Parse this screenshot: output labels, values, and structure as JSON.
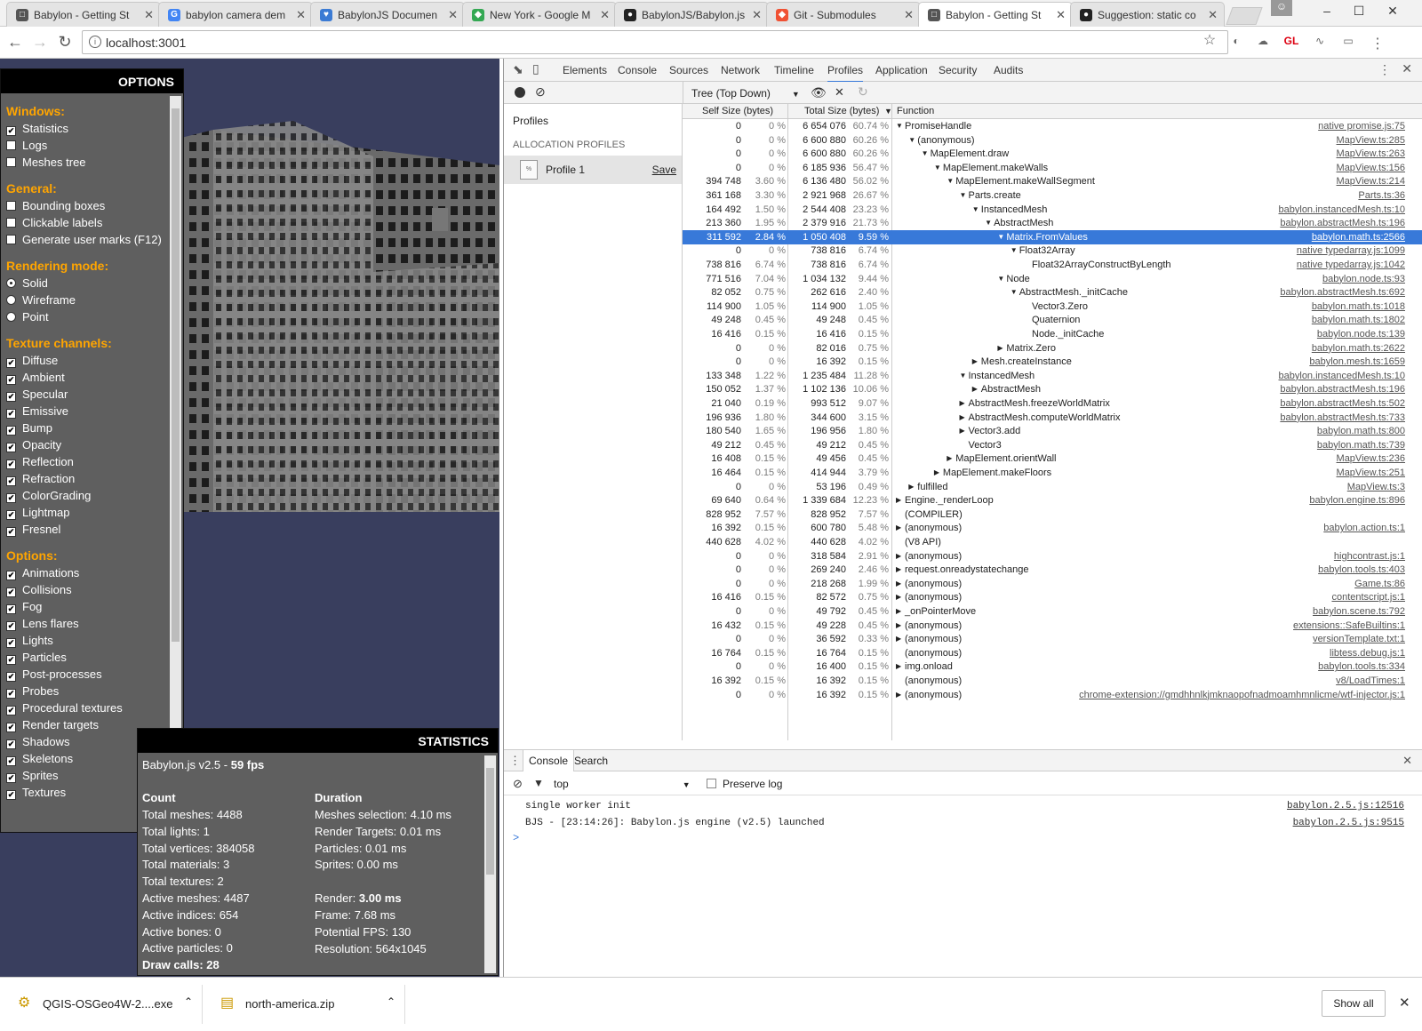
{
  "browser": {
    "tabs": [
      "Babylon - Getting St",
      "babylon camera dem",
      "BabylonJS Documen",
      "New York - Google M",
      "BabylonJS/Babylon.js",
      "Git - Submodules",
      "Babylon - Getting St",
      "Suggestion: static co"
    ],
    "url": "localhost:3001",
    "ext_gl": "GL"
  },
  "options": {
    "title": "OPTIONS",
    "windows_title": "Windows:",
    "windows": [
      "Statistics",
      "Logs",
      "Meshes tree"
    ],
    "general_title": "General:",
    "general": [
      "Bounding boxes",
      "Clickable labels",
      "Generate user marks (F12)"
    ],
    "render_title": "Rendering mode:",
    "render": [
      "Solid",
      "Wireframe",
      "Point"
    ],
    "texture_title": "Texture channels:",
    "textures": [
      "Diffuse",
      "Ambient",
      "Specular",
      "Emissive",
      "Bump",
      "Opacity",
      "Reflection",
      "Refraction",
      "ColorGrading",
      "Lightmap",
      "Fresnel"
    ],
    "opt_title": "Options:",
    "opts": [
      "Animations",
      "Collisions",
      "Fog",
      "Lens flares",
      "Lights",
      "Particles",
      "Post-processes",
      "Probes",
      "Procedural textures",
      "Render targets",
      "Shadows",
      "Skeletons",
      "Sprites",
      "Textures"
    ]
  },
  "stats": {
    "title": "STATISTICS",
    "version": "Babylon.js v2.5 - ",
    "fps": "59 fps",
    "count_title": "Count",
    "duration_title": "Duration",
    "left": [
      "Total meshes: 4488",
      "Total lights: 1",
      "Total vertices: 384058",
      "Total materials: 3",
      "Total textures: 2",
      "Active meshes: 4487",
      "Active indices: 654",
      "Active bones: 0",
      "Active particles: 0"
    ],
    "draw": "Draw calls: 28",
    "right": [
      "Meshes selection: 4.10 ms",
      "Render Targets: 0.01 ms",
      "Particles: 0.01 ms",
      "Sprites: 0.00 ms"
    ],
    "render_label": "Render: ",
    "render_val": "3.00 ms",
    "right2": [
      "Frame: 7.68 ms",
      "Potential FPS: 130",
      "Resolution: 564x1045"
    ]
  },
  "devtools": {
    "tabs": [
      "Elements",
      "Console",
      "Sources",
      "Network",
      "Timeline",
      "Profiles",
      "Application",
      "Security",
      "Audits"
    ],
    "view_select": "Tree (Top Down)",
    "profiles_label": "Profiles",
    "alloc_label": "ALLOCATION PROFILES",
    "profile_name": "Profile 1",
    "save": "Save",
    "columns": [
      "Self Size (bytes)",
      "Total Size (bytes)",
      "Function"
    ],
    "rows": [
      [
        "0",
        "0 %",
        "6 654 076",
        "60.74 %",
        0,
        "PromiseHandle",
        "native promise.js:75",
        1
      ],
      [
        "0",
        "0 %",
        "6 600 880",
        "60.26 %",
        1,
        "(anonymous)",
        "MapView.ts:285",
        1
      ],
      [
        "0",
        "0 %",
        "6 600 880",
        "60.26 %",
        2,
        "MapElement.draw",
        "MapView.ts:263",
        1
      ],
      [
        "0",
        "0 %",
        "6 185 936",
        "56.47 %",
        3,
        "MapElement.makeWalls",
        "MapView.ts:156",
        1
      ],
      [
        "394 748",
        "3.60 %",
        "6 136 480",
        "56.02 %",
        4,
        "MapElement.makeWallSegment",
        "MapView.ts:214",
        1
      ],
      [
        "361 168",
        "3.30 %",
        "2 921 968",
        "26.67 %",
        5,
        "Parts.create",
        "Parts.ts:36",
        1
      ],
      [
        "164 492",
        "1.50 %",
        "2 544 408",
        "23.23 %",
        6,
        "InstancedMesh",
        "babylon.instancedMesh.ts:10",
        1
      ],
      [
        "213 360",
        "1.95 %",
        "2 379 916",
        "21.73 %",
        7,
        "AbstractMesh",
        "babylon.abstractMesh.ts:196",
        1
      ],
      [
        "311 592",
        "2.84 %",
        "1 050 408",
        "9.59 %",
        8,
        "Matrix.FromValues",
        "babylon.math.ts:2566",
        1
      ],
      [
        "0",
        "0 %",
        "738 816",
        "6.74 %",
        9,
        "Float32Array",
        "native typedarray.js:1099",
        1
      ],
      [
        "738 816",
        "6.74 %",
        "738 816",
        "6.74 %",
        10,
        "Float32ArrayConstructByLength",
        "native typedarray.js:1042",
        0
      ],
      [
        "771 516",
        "7.04 %",
        "1 034 132",
        "9.44 %",
        8,
        "Node",
        "babylon.node.ts:93",
        1
      ],
      [
        "82 052",
        "0.75 %",
        "262 616",
        "2.40 %",
        9,
        "AbstractMesh._initCache",
        "babylon.abstractMesh.ts:692",
        1
      ],
      [
        "114 900",
        "1.05 %",
        "114 900",
        "1.05 %",
        10,
        "Vector3.Zero",
        "babylon.math.ts:1018",
        0
      ],
      [
        "49 248",
        "0.45 %",
        "49 248",
        "0.45 %",
        10,
        "Quaternion",
        "babylon.math.ts:1802",
        0
      ],
      [
        "16 416",
        "0.15 %",
        "16 416",
        "0.15 %",
        10,
        "Node._initCache",
        "babylon.node.ts:139",
        0
      ],
      [
        "0",
        "0 %",
        "82 016",
        "0.75 %",
        8,
        "Matrix.Zero",
        "babylon.math.ts:2622",
        2
      ],
      [
        "0",
        "0 %",
        "16 392",
        "0.15 %",
        6,
        "Mesh.createInstance",
        "babylon.mesh.ts:1659",
        2
      ],
      [
        "133 348",
        "1.22 %",
        "1 235 484",
        "11.28 %",
        5,
        "InstancedMesh",
        "babylon.instancedMesh.ts:10",
        1
      ],
      [
        "150 052",
        "1.37 %",
        "1 102 136",
        "10.06 %",
        6,
        "AbstractMesh",
        "babylon.abstractMesh.ts:196",
        2
      ],
      [
        "21 040",
        "0.19 %",
        "993 512",
        "9.07 %",
        5,
        "AbstractMesh.freezeWorldMatrix",
        "babylon.abstractMesh.ts:502",
        2
      ],
      [
        "196 936",
        "1.80 %",
        "344 600",
        "3.15 %",
        5,
        "AbstractMesh.computeWorldMatrix",
        "babylon.abstractMesh.ts:733",
        2
      ],
      [
        "180 540",
        "1.65 %",
        "196 956",
        "1.80 %",
        5,
        "Vector3.add",
        "babylon.math.ts:800",
        2
      ],
      [
        "49 212",
        "0.45 %",
        "49 212",
        "0.45 %",
        5,
        "Vector3",
        "babylon.math.ts:739",
        0
      ],
      [
        "16 408",
        "0.15 %",
        "49 456",
        "0.45 %",
        4,
        "MapElement.orientWall",
        "MapView.ts:236",
        2
      ],
      [
        "16 464",
        "0.15 %",
        "414 944",
        "3.79 %",
        3,
        "MapElement.makeFloors",
        "MapView.ts:251",
        2
      ],
      [
        "0",
        "0 %",
        "53 196",
        "0.49 %",
        1,
        "fulfilled",
        "MapView.ts:3",
        2
      ],
      [
        "69 640",
        "0.64 %",
        "1 339 684",
        "12.23 %",
        0,
        "Engine._renderLoop",
        "babylon.engine.ts:896",
        2
      ],
      [
        "828 952",
        "7.57 %",
        "828 952",
        "7.57 %",
        0,
        "(COMPILER)",
        "",
        0
      ],
      [
        "16 392",
        "0.15 %",
        "600 780",
        "5.48 %",
        0,
        "(anonymous)",
        "babylon.action.ts:1",
        2
      ],
      [
        "440 628",
        "4.02 %",
        "440 628",
        "4.02 %",
        0,
        "(V8 API)",
        "",
        0
      ],
      [
        "0",
        "0 %",
        "318 584",
        "2.91 %",
        0,
        "(anonymous)",
        "highcontrast.js:1",
        2
      ],
      [
        "0",
        "0 %",
        "269 240",
        "2.46 %",
        0,
        "request.onreadystatechange",
        "babylon.tools.ts:403",
        2
      ],
      [
        "0",
        "0 %",
        "218 268",
        "1.99 %",
        0,
        "(anonymous)",
        "Game.ts:86",
        2
      ],
      [
        "16 416",
        "0.15 %",
        "82 572",
        "0.75 %",
        0,
        "(anonymous)",
        "contentscript.js:1",
        2
      ],
      [
        "0",
        "0 %",
        "49 792",
        "0.45 %",
        0,
        "_onPointerMove",
        "babylon.scene.ts:792",
        2
      ],
      [
        "16 432",
        "0.15 %",
        "49 228",
        "0.45 %",
        0,
        "(anonymous)",
        "extensions::SafeBuiltins:1",
        2
      ],
      [
        "0",
        "0 %",
        "36 592",
        "0.33 %",
        0,
        "(anonymous)",
        "versionTemplate.txt:1",
        2
      ],
      [
        "16 764",
        "0.15 %",
        "16 764",
        "0.15 %",
        0,
        "(anonymous)",
        "libtess.debug.js:1",
        0
      ],
      [
        "0",
        "0 %",
        "16 400",
        "0.15 %",
        0,
        "img.onload",
        "babylon.tools.ts:334",
        2
      ],
      [
        "16 392",
        "0.15 %",
        "16 392",
        "0.15 %",
        0,
        "(anonymous)",
        "v8/LoadTimes:1",
        0
      ],
      [
        "0",
        "0 %",
        "16 392",
        "0.15 %",
        0,
        "(anonymous)",
        "chrome-extension://gmdhhnlkjmknaopofnadmoamhmnlicme/wtf-injector.js:1",
        2
      ]
    ],
    "selected_row": 8,
    "console_tabs": [
      "Console",
      "Search"
    ],
    "context": "top",
    "preserve_log": "Preserve log",
    "messages": [
      [
        "single worker init",
        "babylon.2.5.js:12516"
      ],
      [
        "BJS - [23:14:26]: Babylon.js engine (v2.5) launched",
        "babylon.2.5.js:9515"
      ]
    ],
    "prompt": ">"
  },
  "downloads": {
    "items": [
      "QGIS-OSGeo4W-2....exe",
      "north-america.zip"
    ],
    "show_all": "Show all"
  }
}
